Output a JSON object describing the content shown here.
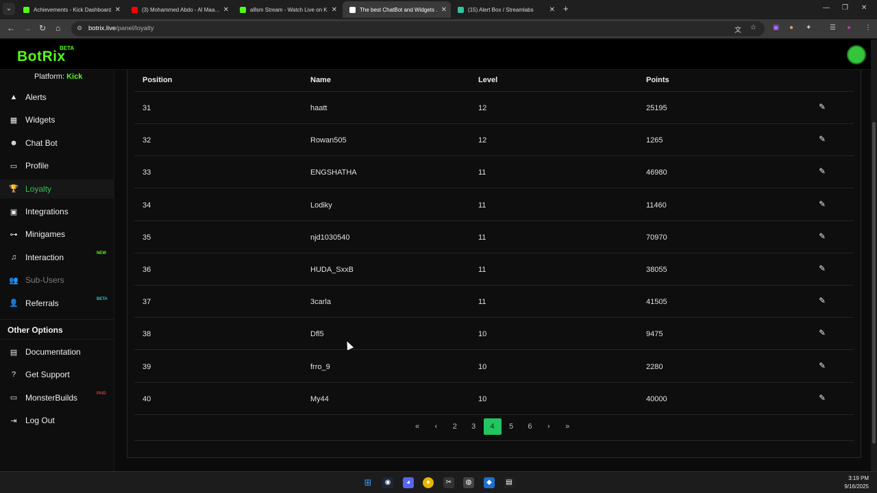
{
  "browser": {
    "tabs": [
      {
        "title": "Achievements - Kick Dashboard",
        "favicon_color": "#53fc18"
      },
      {
        "title": "(3) Mohammed Abdo - Al Maa…",
        "favicon_color": "#ff0000"
      },
      {
        "title": "a8sm Stream - Watch Live on K…",
        "favicon_color": "#53fc18"
      },
      {
        "title": "The best ChatBot and Widgets …",
        "favicon_color": "#ffffff"
      },
      {
        "title": "(15) Alert Box / Streamlabs",
        "favicon_color": "#31c3a2"
      }
    ],
    "active_tab": 3,
    "url_domain": "botrix.live",
    "url_path": "/panel/loyalty"
  },
  "app": {
    "logo": "BotRix",
    "logo_badge": "BETA"
  },
  "sidebar": {
    "platform_label": "Platform:",
    "platform_value": "Kick",
    "items": [
      {
        "label": "Alerts",
        "icon": "warning-icon"
      },
      {
        "label": "Widgets",
        "icon": "grid-icon"
      },
      {
        "label": "Chat Bot",
        "icon": "robot-icon"
      },
      {
        "label": "Profile",
        "icon": "id-card-icon"
      },
      {
        "label": "Loyalty",
        "icon": "trophy-icon"
      },
      {
        "label": "Integrations",
        "icon": "puzzle-icon"
      },
      {
        "label": "Minigames",
        "icon": "gamepad-icon"
      },
      {
        "label": "Interaction",
        "icon": "music-icon",
        "badge": "NEW",
        "badge_color": "#53fc18"
      },
      {
        "label": "Sub-Users",
        "icon": "users-icon"
      },
      {
        "label": "Referrals",
        "icon": "user-plus-icon",
        "badge": "BETA",
        "badge_color": "#31c3c3"
      }
    ],
    "other_title": "Other Options",
    "other_items": [
      {
        "label": "Documentation",
        "icon": "book-icon"
      },
      {
        "label": "Get Support",
        "icon": "question-icon"
      },
      {
        "label": "MonsterBuilds",
        "icon": "laptop-icon",
        "badge": "PAID",
        "badge_color": "#d23a3a"
      },
      {
        "label": "Log Out",
        "icon": "sign-out-icon"
      }
    ]
  },
  "table": {
    "headers": [
      "Position",
      "Name",
      "Level",
      "Points"
    ],
    "rows": [
      {
        "position": "31",
        "name": "haatt",
        "level": "12",
        "points": "25195"
      },
      {
        "position": "32",
        "name": "Rowan505",
        "level": "12",
        "points": "1265"
      },
      {
        "position": "33",
        "name": "ENGSHATHA",
        "level": "11",
        "points": "46980"
      },
      {
        "position": "34",
        "name": "Lodiky",
        "level": "11",
        "points": "11460"
      },
      {
        "position": "35",
        "name": "njd1030540",
        "level": "11",
        "points": "70970"
      },
      {
        "position": "36",
        "name": "HUDA_SxxB",
        "level": "11",
        "points": "38055"
      },
      {
        "position": "37",
        "name": "3carla",
        "level": "11",
        "points": "41505"
      },
      {
        "position": "38",
        "name": "Dfl5",
        "level": "10",
        "points": "9475"
      },
      {
        "position": "39",
        "name": "frro_9",
        "level": "10",
        "points": "2280"
      },
      {
        "position": "40",
        "name": "My44",
        "level": "10",
        "points": "40000"
      }
    ]
  },
  "pagination": {
    "first": "«",
    "prev": "‹",
    "pages": [
      "2",
      "3",
      "4",
      "5",
      "6"
    ],
    "current": "4",
    "next": "›",
    "last": "»"
  },
  "taskbar": {
    "time": "3:19 PM",
    "date": "9/16/2025"
  }
}
